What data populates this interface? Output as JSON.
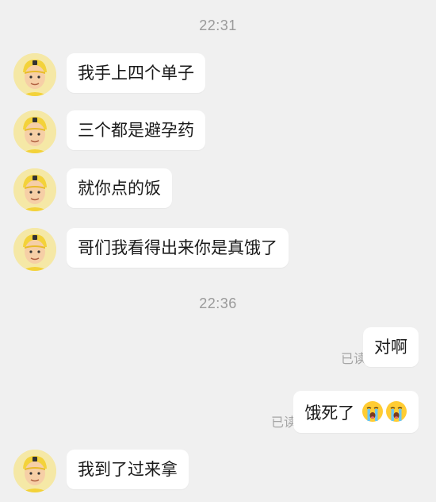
{
  "timestamps": [
    "22:31",
    "22:36"
  ],
  "messages_group1": [
    {
      "side": "in",
      "text": "我手上四个单子"
    },
    {
      "side": "in",
      "text": "三个都是避孕药"
    },
    {
      "side": "in",
      "text": "就你点的饭"
    },
    {
      "side": "in",
      "text": "哥们我看得出来你是真饿了"
    }
  ],
  "messages_group2": [
    {
      "side": "out",
      "text": "对啊",
      "status": "已读"
    },
    {
      "side": "out",
      "text": "饿死了",
      "emoji": [
        "loudly-crying-face",
        "loudly-crying-face"
      ],
      "status": "已读"
    },
    {
      "side": "in",
      "text": "我到了过来拿"
    }
  ],
  "avatar": {
    "icon": "delivery-rider-avatar-icon",
    "color": "#f5e8a6"
  }
}
